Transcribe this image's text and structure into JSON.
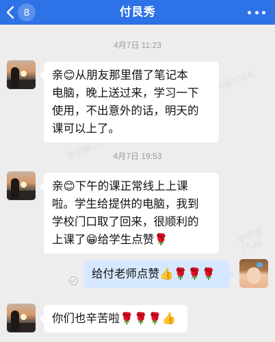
{
  "header": {
    "back_count": "8",
    "title": "付艮秀",
    "back_icon": "chevron-left-icon",
    "more_icon": "more-dots-icon",
    "color": "#2d72e6"
  },
  "messages": [
    {
      "type": "time",
      "text": "4月7日 11:23"
    },
    {
      "type": "received",
      "lines": [
        "亲😊从朋友那里借了笔记本",
        "电脑，晚上送过来，学习一下",
        "使用，不出意外的话，明天的",
        "课可以上了。"
      ]
    },
    {
      "type": "time",
      "text": "4月7日 19:53"
    },
    {
      "type": "received",
      "lines": [
        "亲😊下午的课正常线上上课",
        "啦。学生给提供的电脑，我到",
        "学校门口取了回来，很顺利的",
        "上课了😁给学生点赞🌹"
      ]
    },
    {
      "type": "sent",
      "text": "给付老师点赞👍🌹🌹🌹"
    },
    {
      "type": "received",
      "text": "你们也辛苦啦🌹🌹🌹👍"
    }
  ],
  "watermark": "李明娜2546"
}
